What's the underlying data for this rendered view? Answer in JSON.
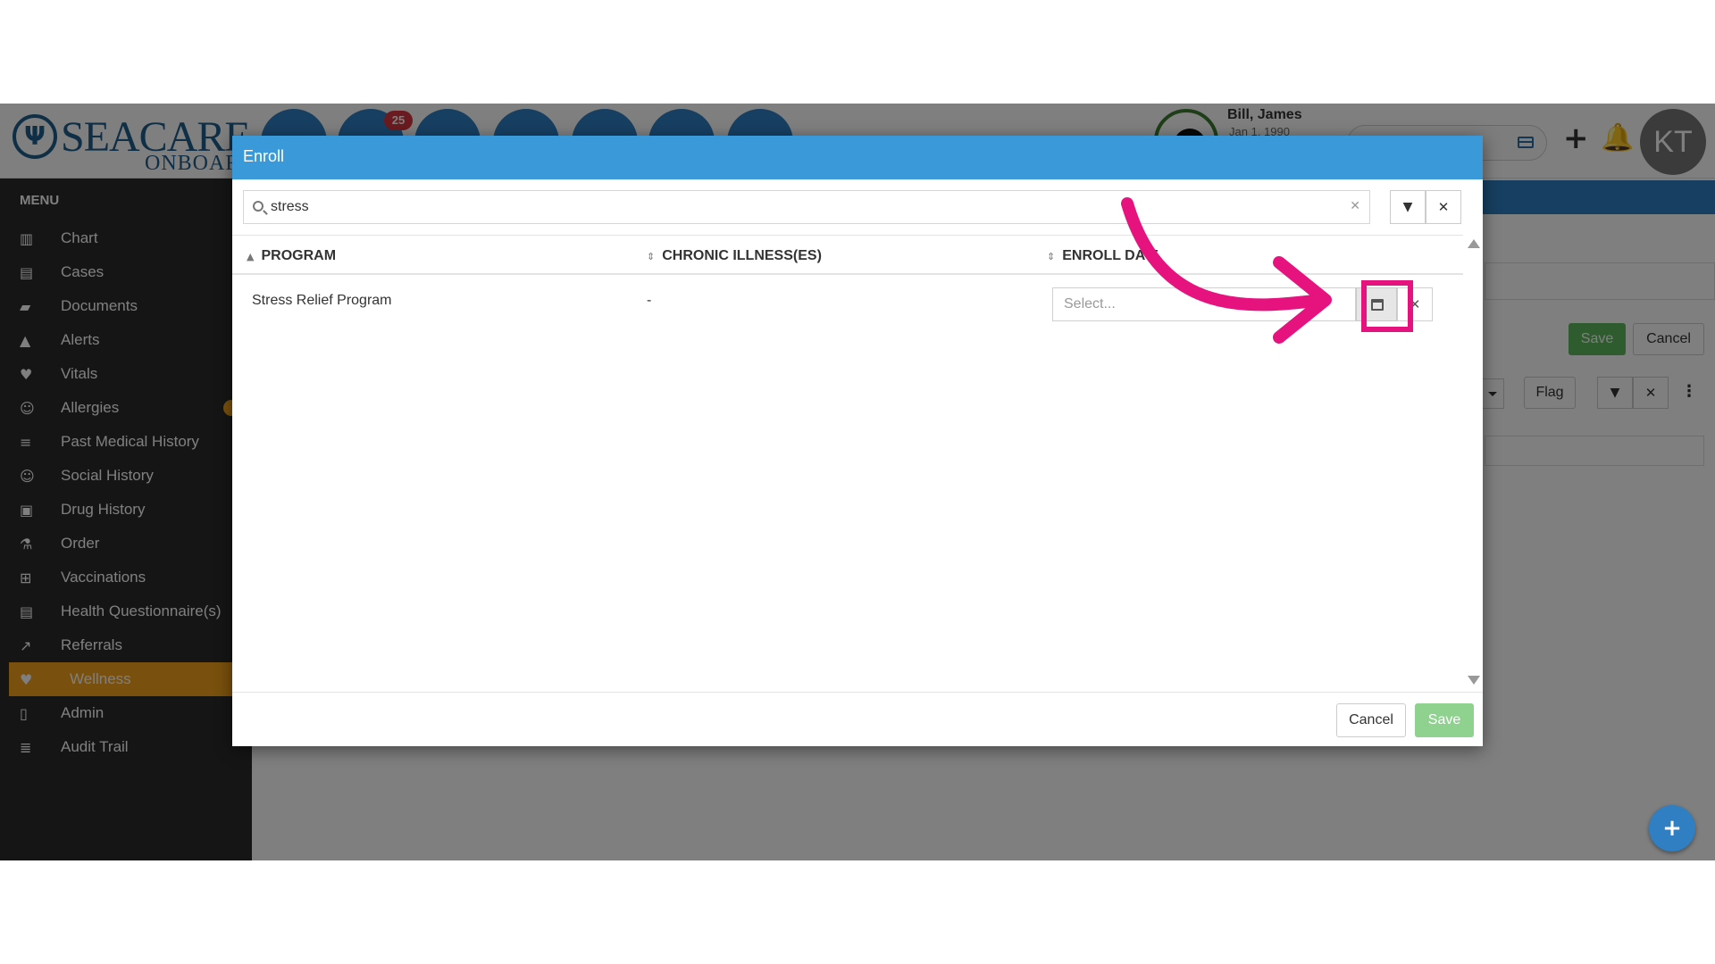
{
  "brand": {
    "logo_main": "SEACARE",
    "logo_sub": "ONBOAR"
  },
  "header": {
    "badge_count": "25",
    "patient_name": "Bill, James",
    "patient_dob": "Jan 1, 1990",
    "user_initials": "KT"
  },
  "sidebar": {
    "title": "MENU",
    "items": [
      {
        "label": "Chart",
        "icon": "bar-chart-icon"
      },
      {
        "label": "Cases",
        "icon": "inbox-icon"
      },
      {
        "label": "Documents",
        "icon": "folder-icon"
      },
      {
        "label": "Alerts",
        "icon": "warning-icon"
      },
      {
        "label": "Vitals",
        "icon": "heart-icon"
      },
      {
        "label": "Allergies",
        "icon": "face-icon"
      },
      {
        "label": "Past Medical History",
        "icon": "sort-list-icon"
      },
      {
        "label": "Social History",
        "icon": "smile-icon"
      },
      {
        "label": "Drug History",
        "icon": "medkit-icon"
      },
      {
        "label": "Order",
        "icon": "flask-icon"
      },
      {
        "label": "Vaccinations",
        "icon": "plus-square-icon"
      },
      {
        "label": "Health Questionnaire(s)",
        "icon": "list-icon"
      },
      {
        "label": "Referrals",
        "icon": "share-icon"
      },
      {
        "label": "Wellness",
        "icon": "heartbeat-icon"
      },
      {
        "label": "Admin",
        "icon": "file-icon"
      },
      {
        "label": "Audit Trail",
        "icon": "sort-amount-icon"
      }
    ],
    "active_item": "Wellness"
  },
  "background": {
    "save_label": "Save",
    "cancel_label": "Cancel",
    "flag_label": "Flag"
  },
  "modal": {
    "title": "Enroll",
    "search": {
      "value": "stress"
    },
    "columns": {
      "program": "PROGRAM",
      "chronic": "CHRONIC ILLNESS(ES)",
      "enroll_date": "ENROLL DATE"
    },
    "rows": [
      {
        "program": "Stress Relief Program",
        "chronic": "-",
        "enroll_placeholder": "Select..."
      }
    ],
    "footer": {
      "cancel_label": "Cancel",
      "save_label": "Save"
    }
  },
  "colors": {
    "accent": "#3a9ad9",
    "active_menu": "#f2a11a",
    "highlight": "#e6137f",
    "save": "#8fd18f"
  }
}
